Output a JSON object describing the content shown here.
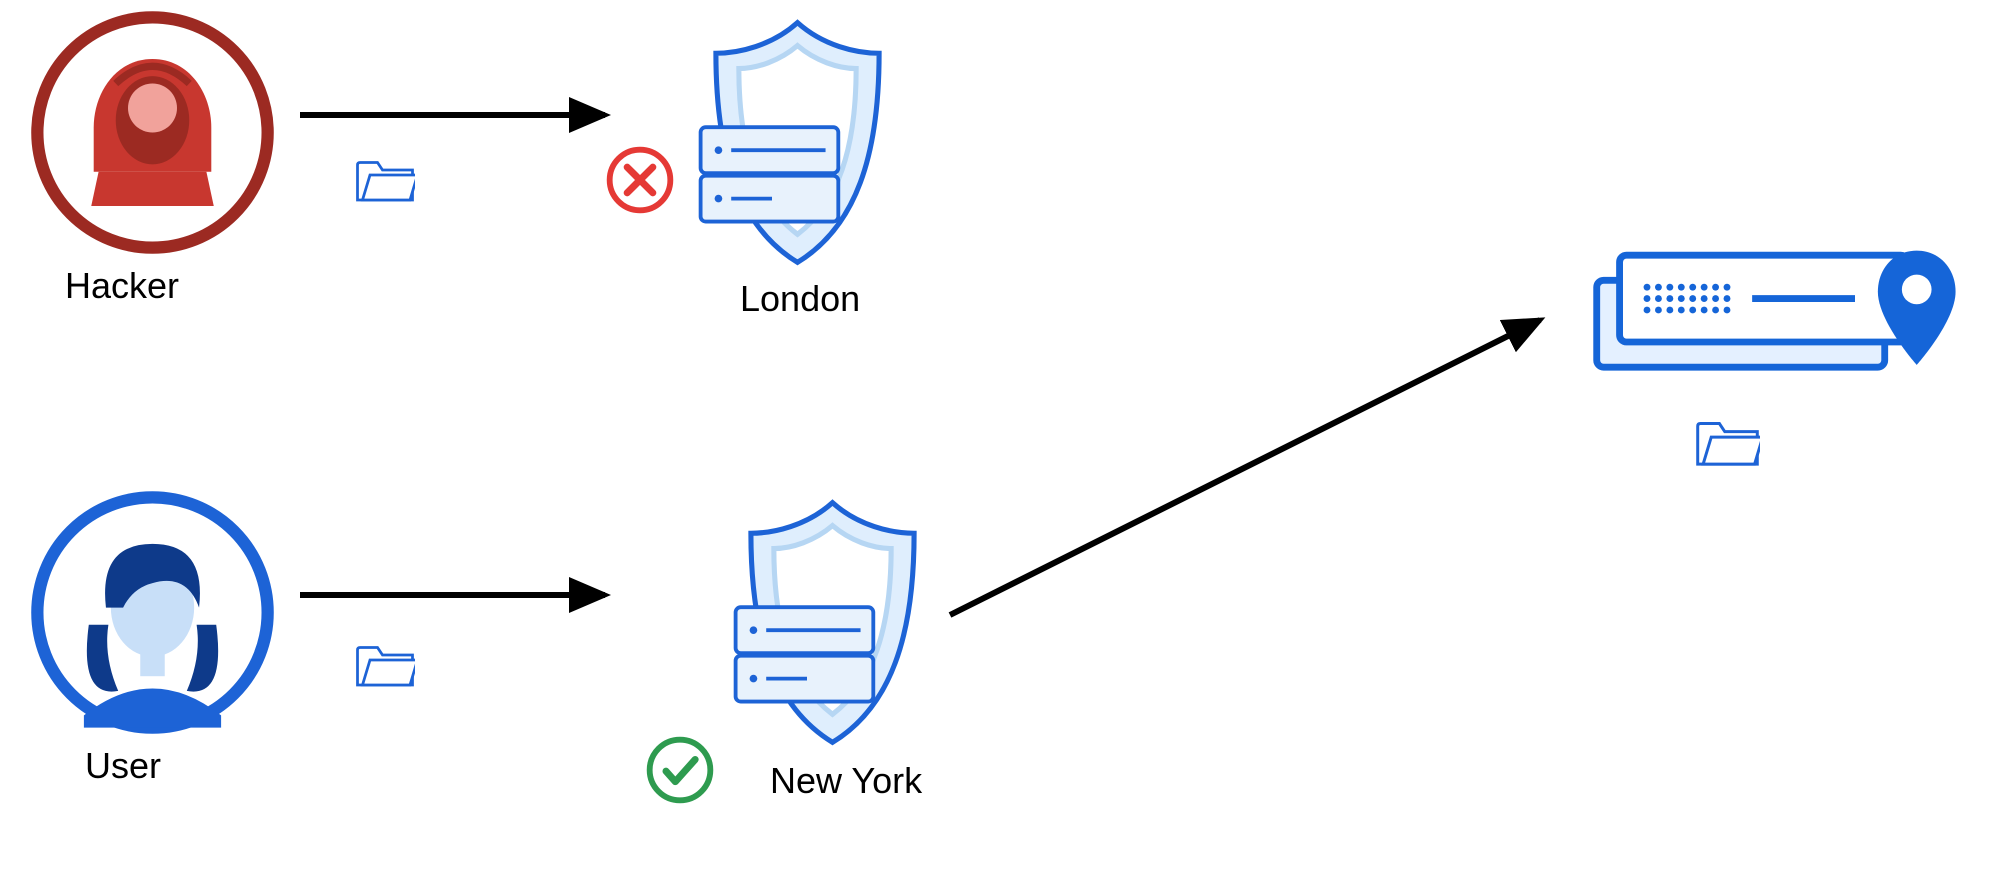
{
  "actors": {
    "hacker": {
      "label": "Hacker"
    },
    "user": {
      "label": "User"
    }
  },
  "servers": {
    "london": {
      "label": "London",
      "status": "denied"
    },
    "newyork": {
      "label": "New York",
      "status": "allowed"
    }
  },
  "icons": {
    "hacker": "hacker-icon",
    "user": "user-icon",
    "folder": "folder-icon",
    "shield_server": "shield-server-icon",
    "deny": "deny-icon",
    "allow": "allow-icon",
    "destination": "ip-location-icon"
  },
  "colors": {
    "hacker_red": "#c8372f",
    "hacker_light": "#f1a29b",
    "user_blue": "#0e3a8a",
    "user_light": "#c8dff8",
    "outline_blue": "#1d63d6",
    "shield_light": "#dfeefd",
    "shield_mid": "#b6d6f3",
    "server_fill": "#e8f2fc",
    "deny_red": "#e53935",
    "allow_green": "#2e9b4f",
    "dest_blue": "#1565d8",
    "dest_light": "#e4f0ff",
    "arrow": "#000000"
  },
  "flows": [
    {
      "from": "hacker",
      "to": "london",
      "result": "denied"
    },
    {
      "from": "user",
      "to": "newyork",
      "result": "allowed"
    },
    {
      "from": "newyork",
      "to": "destination",
      "result": "forward"
    }
  ]
}
